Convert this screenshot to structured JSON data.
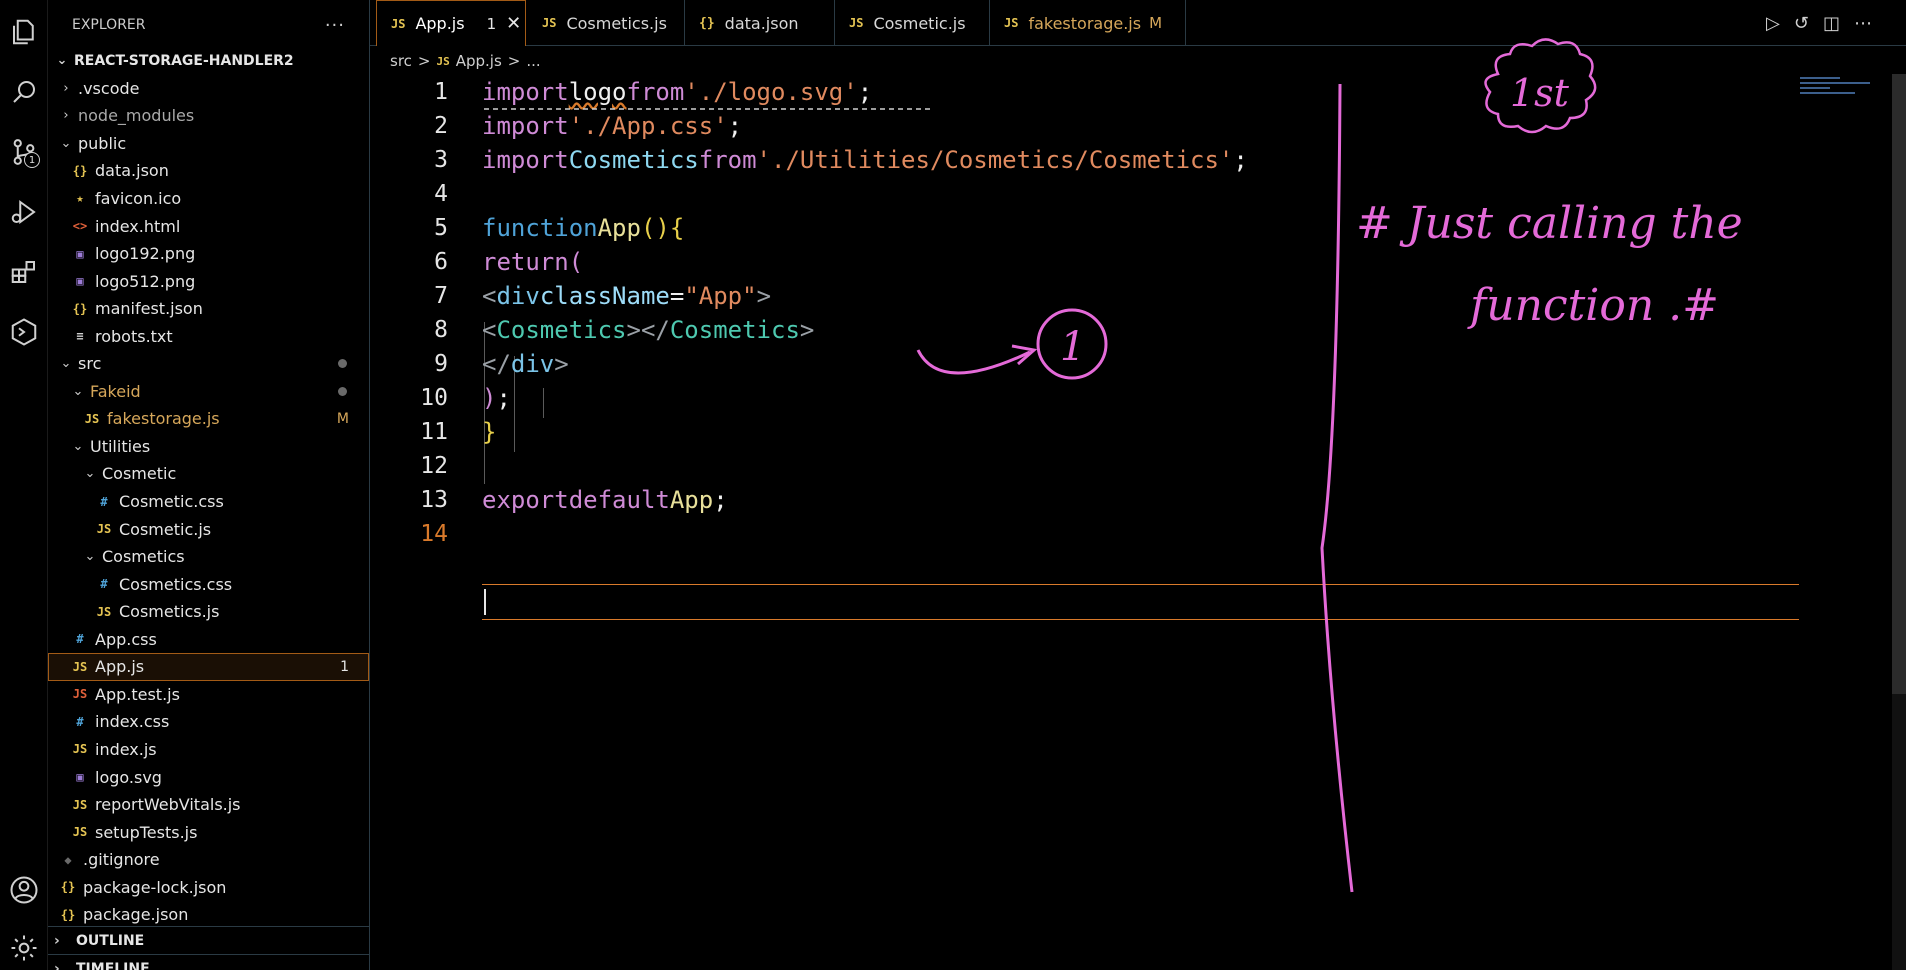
{
  "activity_bar": {
    "items": [
      {
        "name": "explorer-icon"
      },
      {
        "name": "search-icon"
      },
      {
        "name": "source-control-icon",
        "badge": "1"
      },
      {
        "name": "run-debug-icon"
      },
      {
        "name": "extensions-icon"
      },
      {
        "name": "remote-explorer-icon"
      }
    ],
    "bottom": [
      {
        "name": "account-icon"
      },
      {
        "name": "settings-gear-icon"
      }
    ]
  },
  "sidebar": {
    "title": "EXPLORER",
    "more": "···",
    "root": "REACT-STORAGE-HANDLER2",
    "items": [
      {
        "label": ".vscode",
        "kind": "folder",
        "open": false,
        "icon": "",
        "color": "#e6e6e6"
      },
      {
        "label": "node_modules",
        "kind": "folder",
        "open": false,
        "icon": "",
        "color": "#a9a9a9"
      },
      {
        "label": "public",
        "kind": "folder",
        "open": true,
        "icon": "",
        "color": "#e6e6e6"
      },
      {
        "label": "data.json",
        "kind": "file",
        "icon": "{}",
        "icon_color": "#e5c453",
        "color": "#e6e6e6"
      },
      {
        "label": "favicon.ico",
        "kind": "file",
        "icon": "★",
        "icon_color": "#e5c453",
        "color": "#e6e6e6"
      },
      {
        "label": "index.html",
        "kind": "file",
        "icon": "<>",
        "icon_color": "#e0603a",
        "color": "#e6e6e6"
      },
      {
        "label": "logo192.png",
        "kind": "file",
        "icon": "▣",
        "icon_color": "#9c7bd6",
        "color": "#e6e6e6"
      },
      {
        "label": "logo512.png",
        "kind": "file",
        "icon": "▣",
        "icon_color": "#9c7bd6",
        "color": "#e6e6e6"
      },
      {
        "label": "manifest.json",
        "kind": "file",
        "icon": "{}",
        "icon_color": "#e5c453",
        "color": "#e6e6e6"
      },
      {
        "label": "robots.txt",
        "kind": "file",
        "icon": "≡",
        "icon_color": "#cfcfcf",
        "color": "#e6e6e6"
      },
      {
        "label": "src",
        "kind": "folder",
        "open": true,
        "icon": "",
        "color": "#e6e6e6"
      },
      {
        "label": "Fakeid",
        "kind": "folder",
        "open": true,
        "icon": "",
        "color": "#d6a75a"
      },
      {
        "label": "fakestorage.js",
        "kind": "file",
        "icon": "JS",
        "icon_color": "#e5c453",
        "color": "#d6a75a",
        "status": "M"
      },
      {
        "label": "Utilities",
        "kind": "folder",
        "open": true,
        "icon": "",
        "color": "#e6e6e6"
      },
      {
        "label": "Cosmetic",
        "kind": "folder",
        "open": true,
        "icon": "",
        "color": "#e6e6e6"
      },
      {
        "label": "Cosmetic.css",
        "kind": "file",
        "icon": "#",
        "icon_color": "#4fa3d8",
        "color": "#e6e6e6"
      },
      {
        "label": "Cosmetic.js",
        "kind": "file",
        "icon": "JS",
        "icon_color": "#e5c453",
        "color": "#e6e6e6"
      },
      {
        "label": "Cosmetics",
        "kind": "folder",
        "open": true,
        "icon": "",
        "color": "#e6e6e6"
      },
      {
        "label": "Cosmetics.css",
        "kind": "file",
        "icon": "#",
        "icon_color": "#4fa3d8",
        "color": "#e6e6e6"
      },
      {
        "label": "Cosmetics.js",
        "kind": "file",
        "icon": "JS",
        "icon_color": "#e5c453",
        "color": "#e6e6e6"
      },
      {
        "label": "App.css",
        "kind": "file",
        "icon": "#",
        "icon_color": "#4fa3d8",
        "color": "#e6e6e6"
      },
      {
        "label": "App.js",
        "kind": "file",
        "icon": "JS",
        "icon_color": "#e5c453",
        "color": "#e6e6e6",
        "status": "1",
        "selected": true
      },
      {
        "label": "App.test.js",
        "kind": "file",
        "icon": "JS",
        "icon_color": "#e0603a",
        "color": "#e6e6e6"
      },
      {
        "label": "index.css",
        "kind": "file",
        "icon": "#",
        "icon_color": "#4fa3d8",
        "color": "#e6e6e6"
      },
      {
        "label": "index.js",
        "kind": "file",
        "icon": "JS",
        "icon_color": "#e5c453",
        "color": "#e6e6e6"
      },
      {
        "label": "logo.svg",
        "kind": "file",
        "icon": "▣",
        "icon_color": "#9c7bd6",
        "color": "#e6e6e6"
      },
      {
        "label": "reportWebVitals.js",
        "kind": "file",
        "icon": "JS",
        "icon_color": "#e5c453",
        "color": "#e6e6e6"
      },
      {
        "label": "setupTests.js",
        "kind": "file",
        "icon": "JS",
        "icon_color": "#e5c453",
        "color": "#e6e6e6"
      },
      {
        "label": ".gitignore",
        "kind": "file",
        "icon": "◆",
        "icon_color": "#6a6a6a",
        "color": "#e6e6e6"
      },
      {
        "label": "package-lock.json",
        "kind": "file",
        "icon": "{}",
        "icon_color": "#e5c453",
        "color": "#e6e6e6"
      },
      {
        "label": "package.json",
        "kind": "file",
        "icon": "{}",
        "icon_color": "#e5c453",
        "color": "#e6e6e6"
      }
    ],
    "outline_label": "OUTLINE",
    "timeline_label": "TIMELINE"
  },
  "tabs": [
    {
      "label": "App.js",
      "icon": "JS",
      "problems": "1",
      "close": "✕",
      "active": true
    },
    {
      "label": "Cosmetics.js",
      "icon": "JS"
    },
    {
      "label": "data.json",
      "icon": "{}"
    },
    {
      "label": "Cosmetic.js",
      "icon": "JS"
    },
    {
      "label": "fakestorage.js",
      "icon": "JS",
      "modified": "M"
    }
  ],
  "breadcrumb": {
    "parts": [
      "src",
      ">",
      "JS",
      "App.js",
      ">",
      "..."
    ]
  },
  "code": {
    "current_line": "14",
    "lines": [
      {
        "n": "1"
      },
      {
        "n": "2"
      },
      {
        "n": "3"
      },
      {
        "n": "4"
      },
      {
        "n": "5"
      },
      {
        "n": "6"
      },
      {
        "n": "7"
      },
      {
        "n": "8"
      },
      {
        "n": "9"
      },
      {
        "n": "10"
      },
      {
        "n": "11"
      },
      {
        "n": "12"
      },
      {
        "n": "13"
      },
      {
        "n": "14"
      }
    ]
  },
  "annotations": {
    "first_label": "1st",
    "note_line1": "# Just calling the",
    "note_line2": "function .#",
    "circle_label": "1",
    "color": "#e46ad8"
  }
}
